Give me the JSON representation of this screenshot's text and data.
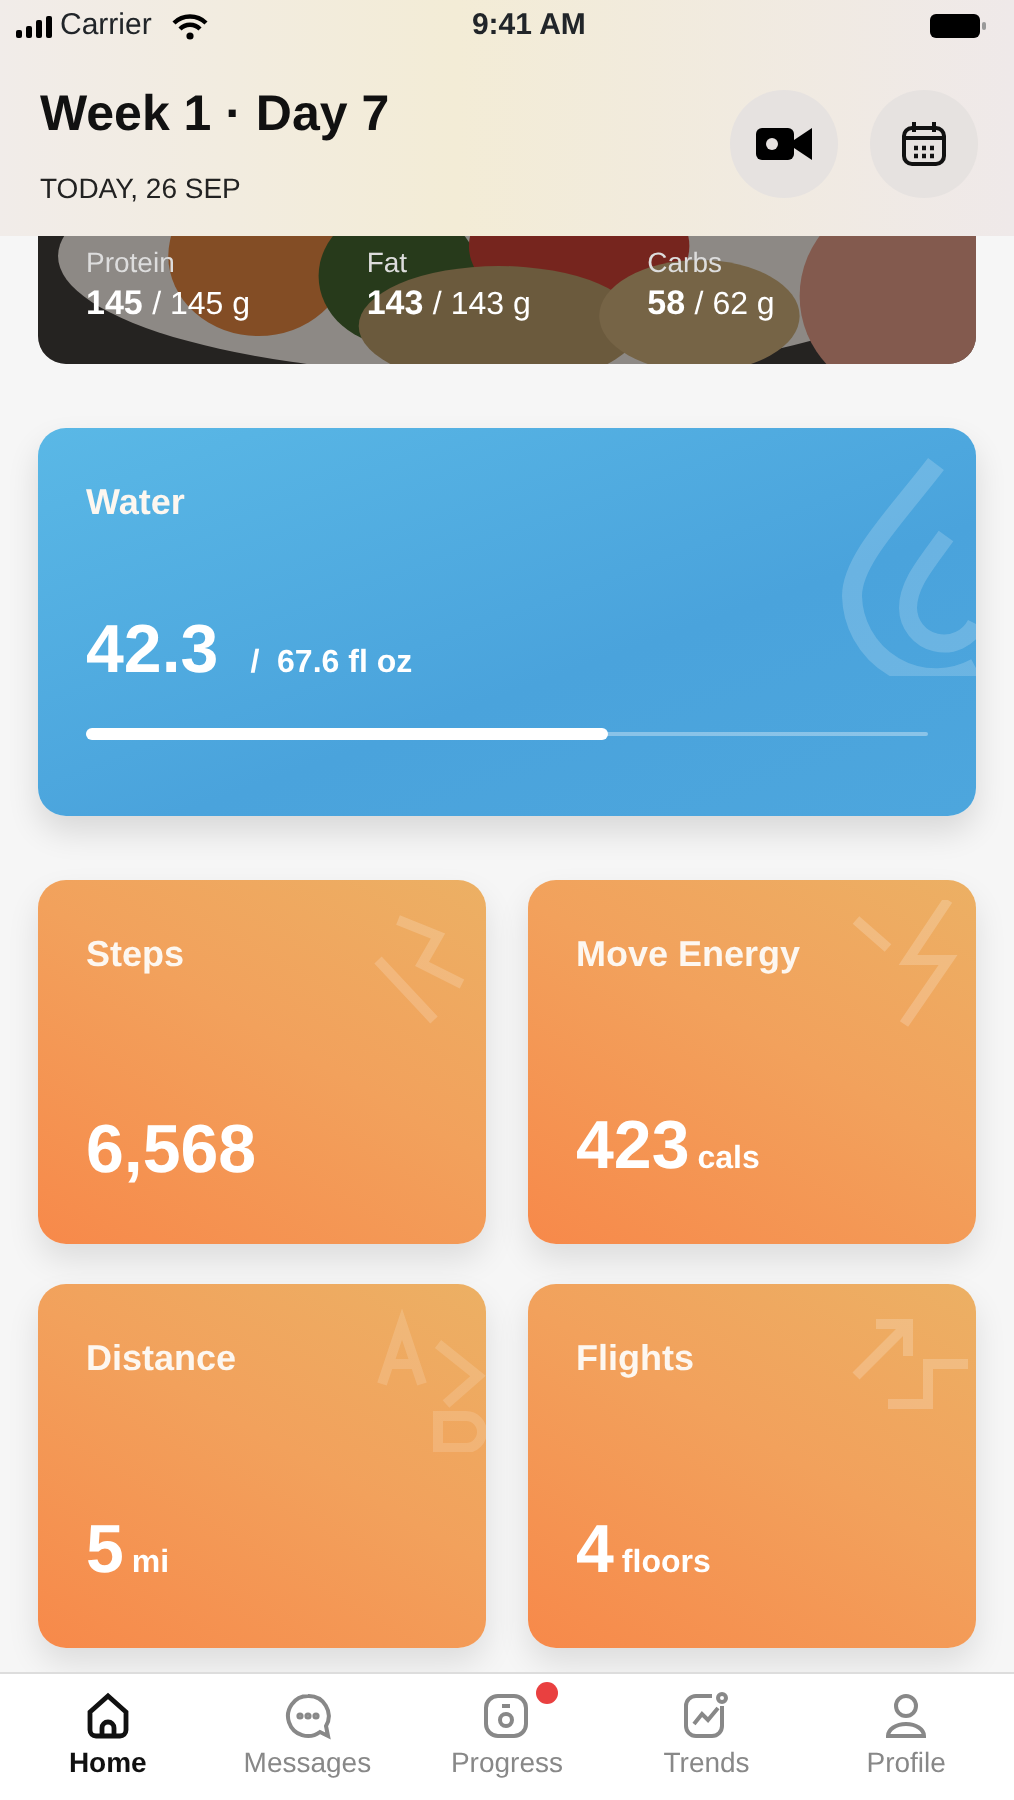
{
  "status_bar": {
    "carrier": "Carrier",
    "time": "9:41 AM"
  },
  "header": {
    "title": "Week 1 · Day 7",
    "subtitle": "TODAY, 26 SEP"
  },
  "macros": [
    {
      "label": "Protein",
      "value": "145",
      "target": "/ 145 g"
    },
    {
      "label": "Fat",
      "value": "143",
      "target": "/ 143 g"
    },
    {
      "label": "Carbs",
      "value": "58",
      "target": "/ 62 g"
    }
  ],
  "water": {
    "title": "Water",
    "value": "42.3",
    "target": "/  67.6 fl oz",
    "level": 0.62
  },
  "stats": [
    {
      "title": "Steps",
      "value": "6,568",
      "kind": "steps"
    },
    {
      "title": "Move Energy",
      "value": "423",
      "unit": "cals",
      "kind": "energy"
    },
    {
      "title": "Distance",
      "value": "5",
      "unit": "mi",
      "kind": "distance"
    },
    {
      "title": "Flights",
      "value": "4",
      "unit": "floors",
      "kind": "flights"
    }
  ],
  "tabs": [
    {
      "label": "Home",
      "kind": "home",
      "selected": true,
      "badge": false
    },
    {
      "label": "Messages",
      "kind": "messages",
      "selected": false,
      "badge": false
    },
    {
      "label": "Progress",
      "kind": "progress",
      "selected": false,
      "badge": true
    },
    {
      "label": "Trends",
      "kind": "trends",
      "selected": false,
      "badge": false
    },
    {
      "label": "Profile",
      "kind": "profile",
      "selected": false,
      "badge": false
    }
  ]
}
